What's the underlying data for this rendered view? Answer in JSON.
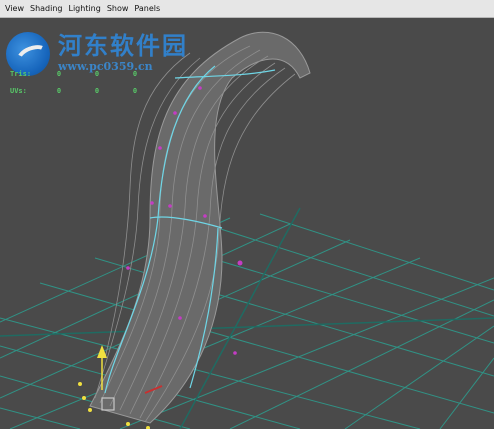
{
  "menu": {
    "items": [
      "View",
      "Shading",
      "Lighting",
      "Show",
      "Panels"
    ]
  },
  "hud": {
    "rows": [
      {
        "label": "Tris:",
        "values": [
          "0",
          "0",
          "0"
        ]
      },
      {
        "label": "UVs:",
        "values": [
          "0",
          "0",
          "0"
        ]
      }
    ],
    "text_color": "#58c868"
  },
  "watermark": {
    "title": "河东软件园",
    "url": "www.pc0359.cn",
    "color": "#2f86d8"
  },
  "scene": {
    "background": "#4a4a4a",
    "grid_color": "#2e9a8c",
    "mesh_color": "#8a8a8a",
    "edge_highlight": "#6fd6e6",
    "vertex_color": "#c43cc4",
    "selection_color": "#f0e040"
  }
}
